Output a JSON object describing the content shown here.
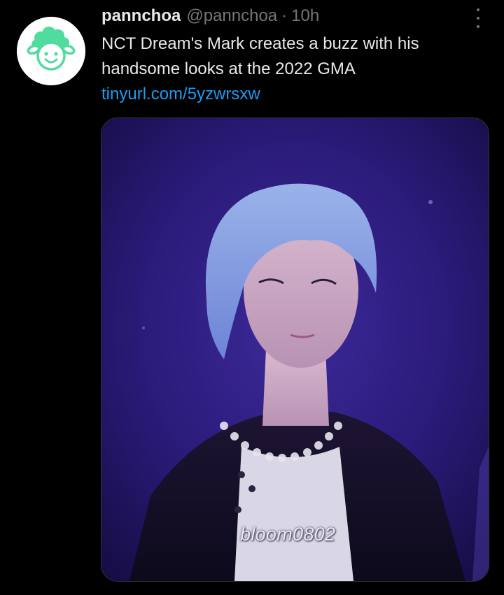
{
  "tweet": {
    "display_name": "pannchoa",
    "handle": "@pannchoa",
    "separator": "·",
    "time": "10h",
    "text_line1": "NCT Dream's Mark creates a buzz with his",
    "text_line2": "handsome looks at the 2022 GMA",
    "link": "tinyurl.com/5yzwrsxw",
    "media": {
      "watermark": "bloom0802"
    }
  },
  "colors": {
    "background": "#000000",
    "primary_text": "#e7e9ea",
    "secondary_text": "#71767b",
    "link": "#1d9bf0",
    "avatar_accent": "#4fdc9e"
  },
  "icons": {
    "more": "vertical-ellipsis-icon",
    "avatar": "smiling-sheep-logo"
  }
}
